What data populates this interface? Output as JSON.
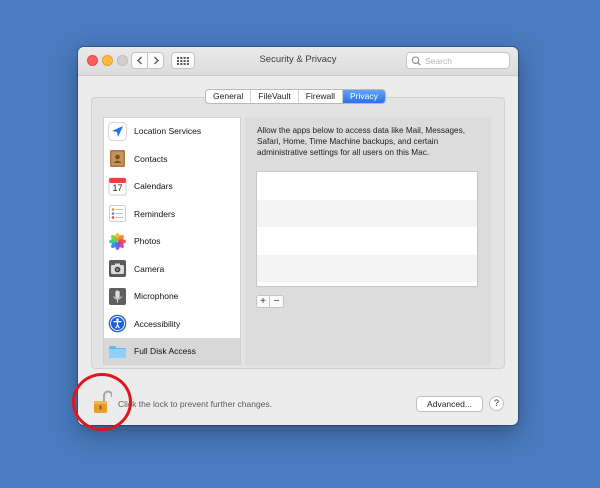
{
  "window": {
    "title": "Security & Privacy",
    "search_placeholder": "Search"
  },
  "tabs": [
    {
      "label": "General",
      "active": false
    },
    {
      "label": "FileVault",
      "active": false
    },
    {
      "label": "Firewall",
      "active": false
    },
    {
      "label": "Privacy",
      "active": true
    }
  ],
  "sidebar": {
    "items": [
      {
        "label": "Location Services",
        "icon": "location-arrow-icon",
        "selected": false
      },
      {
        "label": "Contacts",
        "icon": "contacts-book-icon",
        "selected": false
      },
      {
        "label": "Calendars",
        "icon": "calendar-icon",
        "calendar_day": "17",
        "selected": false
      },
      {
        "label": "Reminders",
        "icon": "reminders-list-icon",
        "selected": false
      },
      {
        "label": "Photos",
        "icon": "photos-flower-icon",
        "selected": false
      },
      {
        "label": "Camera",
        "icon": "camera-icon",
        "selected": false
      },
      {
        "label": "Microphone",
        "icon": "microphone-icon",
        "selected": false
      },
      {
        "label": "Accessibility",
        "icon": "accessibility-icon",
        "selected": false
      },
      {
        "label": "Full Disk Access",
        "icon": "folder-icon",
        "selected": true
      }
    ]
  },
  "panel": {
    "description": "Allow the apps below to access data like Mail, Messages, Safari, Home, Time Machine backups, and certain administrative settings for all users on this Mac.",
    "add_label": "+",
    "remove_label": "−"
  },
  "footer": {
    "lock_message": "Click the lock to prevent further changes.",
    "advanced_label": "Advanced...",
    "help_label": "?"
  },
  "colors": {
    "desktop": "#4a7bc0",
    "accent": "#2a72ec",
    "annotation_circle": "#e0161c"
  }
}
